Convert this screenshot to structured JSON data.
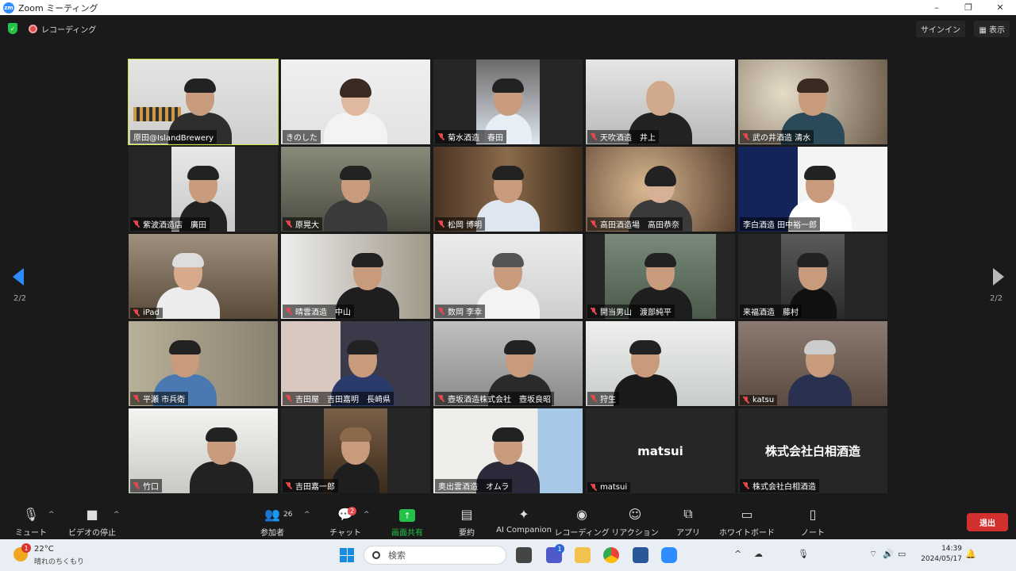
{
  "window": {
    "logo": "zm",
    "title": "Zoom ミーティング",
    "controls": [
      "–",
      "❐",
      "✕"
    ]
  },
  "top": {
    "recording": "レコーディング",
    "signin": "サインイン",
    "view": "表示"
  },
  "pager": {
    "left": "2/2",
    "right": "2/2"
  },
  "tiles": [
    {
      "name": "原田@IslandBrewery",
      "muted": false,
      "active": true
    },
    {
      "name": "きのした",
      "muted": false
    },
    {
      "name": "菊水酒造　春田",
      "muted": true
    },
    {
      "name": "天吹酒造　井上",
      "muted": true
    },
    {
      "name": "武の井酒造 清水",
      "muted": true
    },
    {
      "name": "紫波酒造店　廣田",
      "muted": true
    },
    {
      "name": "原晃大",
      "muted": true
    },
    {
      "name": "松岡 博明",
      "muted": true
    },
    {
      "name": "高田酒造場　高田恭奈",
      "muted": true
    },
    {
      "name": "李白酒造 田中裕一郎",
      "muted": false
    },
    {
      "name": "iPad",
      "muted": true
    },
    {
      "name": "晴雲酒造　中山",
      "muted": true
    },
    {
      "name": "数岡 李幸",
      "muted": true
    },
    {
      "name": "開当男山　渡部純平",
      "muted": true
    },
    {
      "name": "来福酒造　藤村",
      "muted": false
    },
    {
      "name": "平瀬 市兵衛",
      "muted": true
    },
    {
      "name": "吉田屋　吉田嘉明　長崎県",
      "muted": true
    },
    {
      "name": "壺坂酒造株式会社　壺坂良昭",
      "muted": true
    },
    {
      "name": "狩生",
      "muted": true
    },
    {
      "name": "katsu",
      "muted": true
    },
    {
      "name": "竹口",
      "muted": true
    },
    {
      "name": "吉田嘉一郎",
      "muted": true
    },
    {
      "name": "奥出雲酒造　オムラ",
      "muted": false
    },
    {
      "name": "matsui",
      "muted": true,
      "display": "matsui"
    },
    {
      "name": "株式会社白相酒造",
      "muted": true,
      "display": "株式会社白相酒造"
    }
  ],
  "toolbar": {
    "mute": "ミュート",
    "video": "ビデオの停止",
    "participants": "参加者",
    "participants_count": "26",
    "chat": "チャット",
    "chat_badge": "2",
    "share": "画面共有",
    "summary": "要約",
    "ai": "AI Companion",
    "record": "レコーディング",
    "reaction": "リアクション",
    "apps": "アプリ",
    "whiteboard": "ホワイトボード",
    "notes": "ノート",
    "leave": "退出"
  },
  "taskbar": {
    "weather_badge": "1",
    "temp": "22°C",
    "weather": "晴れのちくもり",
    "search": "検索",
    "teams_badge": "1",
    "time": "14:39",
    "date": "2024/05/17"
  },
  "colors": {
    "active_outline": "#cde33c",
    "share_green": "#23c24a",
    "leave_red": "#d2302f",
    "zoom_blue": "#2d8cff"
  }
}
